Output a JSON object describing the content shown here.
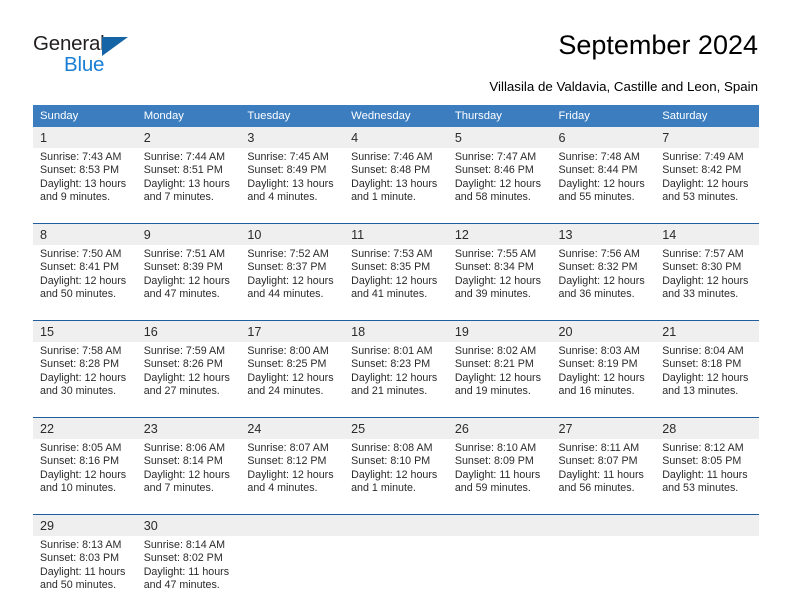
{
  "brand": {
    "name_top": "General",
    "name_bottom": "Blue",
    "triangle_color": "#1565a6",
    "blue_color": "#1a7fd4"
  },
  "header": {
    "title": "September 2024",
    "subtitle": "Villasila de Valdavia, Castille and Leon, Spain"
  },
  "theme": {
    "header_bg": "#3b7dbf",
    "daynum_bg": "#efefef",
    "rule_color": "#1f5fa0"
  },
  "calendar": {
    "weekday_headers": [
      "Sunday",
      "Monday",
      "Tuesday",
      "Wednesday",
      "Thursday",
      "Friday",
      "Saturday"
    ],
    "weeks": [
      [
        {
          "day": "1",
          "sunrise": "Sunrise: 7:43 AM",
          "sunset": "Sunset: 8:53 PM",
          "daylight1": "Daylight: 13 hours",
          "daylight2": "and 9 minutes."
        },
        {
          "day": "2",
          "sunrise": "Sunrise: 7:44 AM",
          "sunset": "Sunset: 8:51 PM",
          "daylight1": "Daylight: 13 hours",
          "daylight2": "and 7 minutes."
        },
        {
          "day": "3",
          "sunrise": "Sunrise: 7:45 AM",
          "sunset": "Sunset: 8:49 PM",
          "daylight1": "Daylight: 13 hours",
          "daylight2": "and 4 minutes."
        },
        {
          "day": "4",
          "sunrise": "Sunrise: 7:46 AM",
          "sunset": "Sunset: 8:48 PM",
          "daylight1": "Daylight: 13 hours",
          "daylight2": "and 1 minute."
        },
        {
          "day": "5",
          "sunrise": "Sunrise: 7:47 AM",
          "sunset": "Sunset: 8:46 PM",
          "daylight1": "Daylight: 12 hours",
          "daylight2": "and 58 minutes."
        },
        {
          "day": "6",
          "sunrise": "Sunrise: 7:48 AM",
          "sunset": "Sunset: 8:44 PM",
          "daylight1": "Daylight: 12 hours",
          "daylight2": "and 55 minutes."
        },
        {
          "day": "7",
          "sunrise": "Sunrise: 7:49 AM",
          "sunset": "Sunset: 8:42 PM",
          "daylight1": "Daylight: 12 hours",
          "daylight2": "and 53 minutes."
        }
      ],
      [
        {
          "day": "8",
          "sunrise": "Sunrise: 7:50 AM",
          "sunset": "Sunset: 8:41 PM",
          "daylight1": "Daylight: 12 hours",
          "daylight2": "and 50 minutes."
        },
        {
          "day": "9",
          "sunrise": "Sunrise: 7:51 AM",
          "sunset": "Sunset: 8:39 PM",
          "daylight1": "Daylight: 12 hours",
          "daylight2": "and 47 minutes."
        },
        {
          "day": "10",
          "sunrise": "Sunrise: 7:52 AM",
          "sunset": "Sunset: 8:37 PM",
          "daylight1": "Daylight: 12 hours",
          "daylight2": "and 44 minutes."
        },
        {
          "day": "11",
          "sunrise": "Sunrise: 7:53 AM",
          "sunset": "Sunset: 8:35 PM",
          "daylight1": "Daylight: 12 hours",
          "daylight2": "and 41 minutes."
        },
        {
          "day": "12",
          "sunrise": "Sunrise: 7:55 AM",
          "sunset": "Sunset: 8:34 PM",
          "daylight1": "Daylight: 12 hours",
          "daylight2": "and 39 minutes."
        },
        {
          "day": "13",
          "sunrise": "Sunrise: 7:56 AM",
          "sunset": "Sunset: 8:32 PM",
          "daylight1": "Daylight: 12 hours",
          "daylight2": "and 36 minutes."
        },
        {
          "day": "14",
          "sunrise": "Sunrise: 7:57 AM",
          "sunset": "Sunset: 8:30 PM",
          "daylight1": "Daylight: 12 hours",
          "daylight2": "and 33 minutes."
        }
      ],
      [
        {
          "day": "15",
          "sunrise": "Sunrise: 7:58 AM",
          "sunset": "Sunset: 8:28 PM",
          "daylight1": "Daylight: 12 hours",
          "daylight2": "and 30 minutes."
        },
        {
          "day": "16",
          "sunrise": "Sunrise: 7:59 AM",
          "sunset": "Sunset: 8:26 PM",
          "daylight1": "Daylight: 12 hours",
          "daylight2": "and 27 minutes."
        },
        {
          "day": "17",
          "sunrise": "Sunrise: 8:00 AM",
          "sunset": "Sunset: 8:25 PM",
          "daylight1": "Daylight: 12 hours",
          "daylight2": "and 24 minutes."
        },
        {
          "day": "18",
          "sunrise": "Sunrise: 8:01 AM",
          "sunset": "Sunset: 8:23 PM",
          "daylight1": "Daylight: 12 hours",
          "daylight2": "and 21 minutes."
        },
        {
          "day": "19",
          "sunrise": "Sunrise: 8:02 AM",
          "sunset": "Sunset: 8:21 PM",
          "daylight1": "Daylight: 12 hours",
          "daylight2": "and 19 minutes."
        },
        {
          "day": "20",
          "sunrise": "Sunrise: 8:03 AM",
          "sunset": "Sunset: 8:19 PM",
          "daylight1": "Daylight: 12 hours",
          "daylight2": "and 16 minutes."
        },
        {
          "day": "21",
          "sunrise": "Sunrise: 8:04 AM",
          "sunset": "Sunset: 8:18 PM",
          "daylight1": "Daylight: 12 hours",
          "daylight2": "and 13 minutes."
        }
      ],
      [
        {
          "day": "22",
          "sunrise": "Sunrise: 8:05 AM",
          "sunset": "Sunset: 8:16 PM",
          "daylight1": "Daylight: 12 hours",
          "daylight2": "and 10 minutes."
        },
        {
          "day": "23",
          "sunrise": "Sunrise: 8:06 AM",
          "sunset": "Sunset: 8:14 PM",
          "daylight1": "Daylight: 12 hours",
          "daylight2": "and 7 minutes."
        },
        {
          "day": "24",
          "sunrise": "Sunrise: 8:07 AM",
          "sunset": "Sunset: 8:12 PM",
          "daylight1": "Daylight: 12 hours",
          "daylight2": "and 4 minutes."
        },
        {
          "day": "25",
          "sunrise": "Sunrise: 8:08 AM",
          "sunset": "Sunset: 8:10 PM",
          "daylight1": "Daylight: 12 hours",
          "daylight2": "and 1 minute."
        },
        {
          "day": "26",
          "sunrise": "Sunrise: 8:10 AM",
          "sunset": "Sunset: 8:09 PM",
          "daylight1": "Daylight: 11 hours",
          "daylight2": "and 59 minutes."
        },
        {
          "day": "27",
          "sunrise": "Sunrise: 8:11 AM",
          "sunset": "Sunset: 8:07 PM",
          "daylight1": "Daylight: 11 hours",
          "daylight2": "and 56 minutes."
        },
        {
          "day": "28",
          "sunrise": "Sunrise: 8:12 AM",
          "sunset": "Sunset: 8:05 PM",
          "daylight1": "Daylight: 11 hours",
          "daylight2": "and 53 minutes."
        }
      ],
      [
        {
          "day": "29",
          "sunrise": "Sunrise: 8:13 AM",
          "sunset": "Sunset: 8:03 PM",
          "daylight1": "Daylight: 11 hours",
          "daylight2": "and 50 minutes."
        },
        {
          "day": "30",
          "sunrise": "Sunrise: 8:14 AM",
          "sunset": "Sunset: 8:02 PM",
          "daylight1": "Daylight: 11 hours",
          "daylight2": "and 47 minutes."
        },
        {
          "day": "",
          "sunrise": "",
          "sunset": "",
          "daylight1": "",
          "daylight2": ""
        },
        {
          "day": "",
          "sunrise": "",
          "sunset": "",
          "daylight1": "",
          "daylight2": ""
        },
        {
          "day": "",
          "sunrise": "",
          "sunset": "",
          "daylight1": "",
          "daylight2": ""
        },
        {
          "day": "",
          "sunrise": "",
          "sunset": "",
          "daylight1": "",
          "daylight2": ""
        },
        {
          "day": "",
          "sunrise": "",
          "sunset": "",
          "daylight1": "",
          "daylight2": ""
        }
      ]
    ]
  }
}
